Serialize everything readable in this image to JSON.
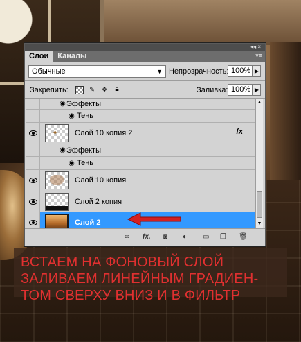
{
  "panel": {
    "tabs": [
      {
        "label": "Слои",
        "active": true
      },
      {
        "label": "Каналы",
        "active": false
      }
    ],
    "titlebar_controls": "◂◂  ×",
    "menu_icon": "▾≡",
    "blend_mode": "Обычные",
    "opacity_label": "Непрозрачность:",
    "opacity_value": "100%",
    "lock_label": "Закрепить:",
    "fill_label": "Заливка:",
    "fill_value": "100%"
  },
  "layers": [
    {
      "type": "effect-header",
      "label": "Эффекты"
    },
    {
      "type": "effect",
      "label": "Тень"
    },
    {
      "type": "layer",
      "label": "Слой 10 копия 2",
      "has_fx": true,
      "fx_label": "fx"
    },
    {
      "type": "effect-header",
      "label": "Эффекты"
    },
    {
      "type": "effect",
      "label": "Тень"
    },
    {
      "type": "layer",
      "label": "Слой 10 копия",
      "has_fx": false
    },
    {
      "type": "layer",
      "label": "Слой 2 копия",
      "has_fx": false
    },
    {
      "type": "layer",
      "label": "Слой 2",
      "has_fx": false,
      "selected": true
    }
  ],
  "toolbar": {
    "link_icon": "link-icon",
    "fx_label": "fx.",
    "mask_icon": "mask-icon",
    "adjust_icon": "adjustment-icon",
    "folder_icon": "folder-icon",
    "new_icon": "new-layer-icon",
    "trash_icon": "trash-icon"
  },
  "instruction": {
    "lines": [
      "ВСТАЕМ НА ФОНОВЫЙ СЛОЙ",
      "ЗАЛИВАЕМ ЛИНЕЙНЫМ ГРАДИЕН-",
      "ТОМ СВЕРХУ ВНИЗ И В ФИЛЬТР"
    ],
    "color": "#e03030"
  },
  "colors": {
    "selected_row": "#3399ff",
    "panel_bg": "#d3d3d3",
    "arrow": "#d42020"
  }
}
